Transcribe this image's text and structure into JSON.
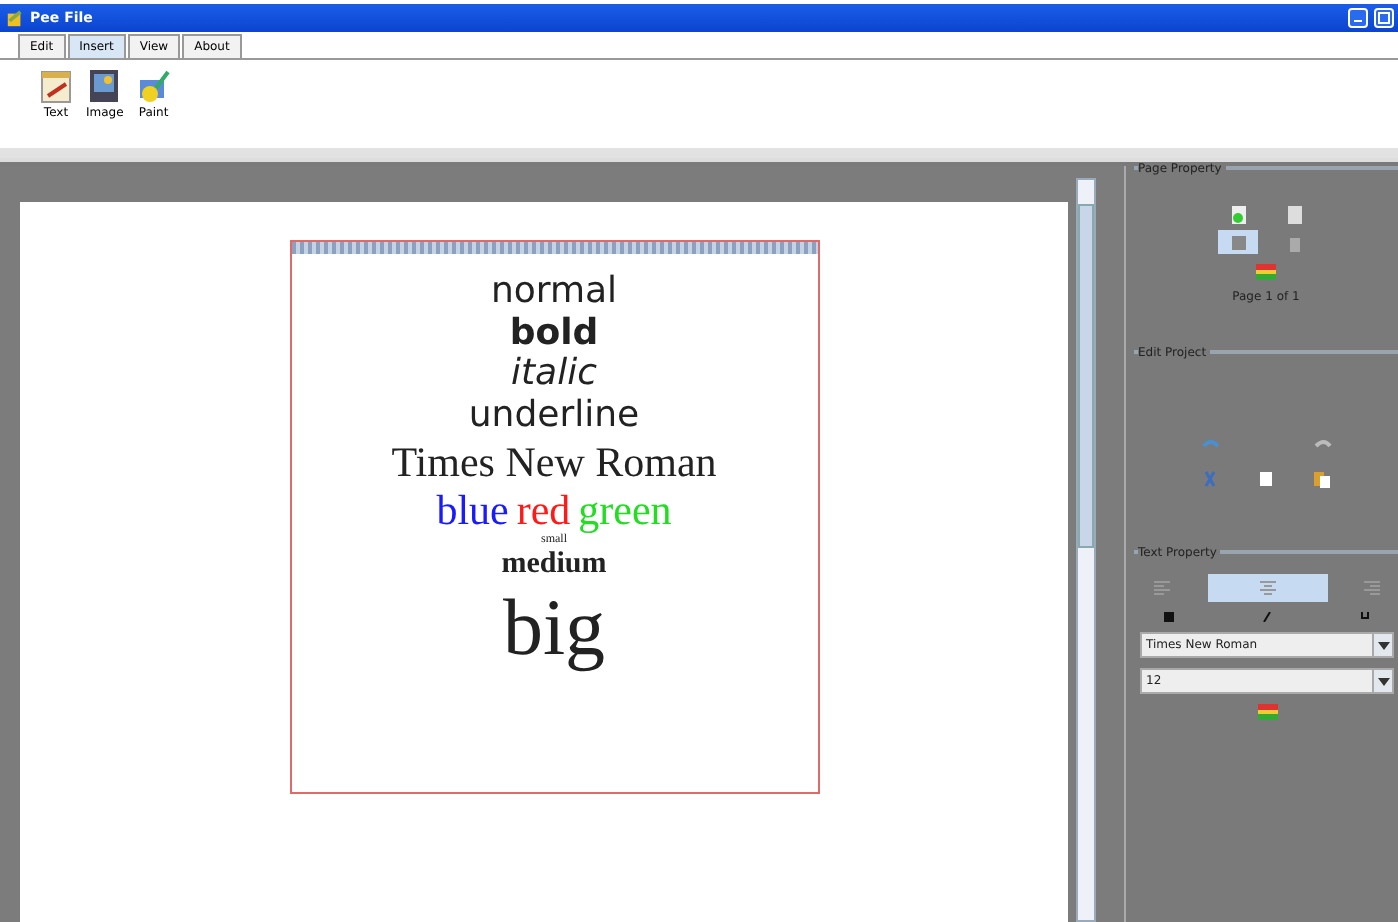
{
  "window": {
    "title": "Pee File"
  },
  "tabs": [
    {
      "label": "Edit",
      "selected": false
    },
    {
      "label": "Insert",
      "selected": true
    },
    {
      "label": "View",
      "selected": false
    },
    {
      "label": "About",
      "selected": false
    }
  ],
  "toolbar": [
    {
      "label": "Text",
      "kind": "text"
    },
    {
      "label": "Image",
      "kind": "image"
    },
    {
      "label": "Paint",
      "kind": "paint"
    }
  ],
  "document": {
    "lines": [
      {
        "kind": "normal",
        "segments": [
          {
            "text": "normal"
          }
        ]
      },
      {
        "kind": "bold",
        "segments": [
          {
            "text": "bold"
          }
        ]
      },
      {
        "kind": "italic",
        "segments": [
          {
            "text": "italic"
          }
        ]
      },
      {
        "kind": "underline",
        "segments": [
          {
            "text": "underline"
          }
        ]
      },
      {
        "kind": "times",
        "segments": [
          {
            "text": "Times New Roman"
          }
        ]
      },
      {
        "kind": "colored",
        "segments": [
          {
            "text": "blue",
            "color": "#1a1aff"
          },
          {
            "text": "red",
            "color": "#ff1a1a"
          },
          {
            "text": "green",
            "color": "#22dd22"
          }
        ]
      },
      {
        "kind": "small",
        "segments": [
          {
            "text": "small"
          }
        ]
      },
      {
        "kind": "medium",
        "segments": [
          {
            "text": "medium"
          }
        ]
      },
      {
        "kind": "big",
        "segments": [
          {
            "text": "big"
          }
        ]
      }
    ]
  },
  "page_property": {
    "title": "Page Property",
    "page_label": "Page 1 of 1"
  },
  "edit_project": {
    "title": "Edit Project"
  },
  "text_property": {
    "title": "Text Property",
    "alignments": [
      {
        "kind": "left",
        "selected": false
      },
      {
        "kind": "center",
        "selected": true
      },
      {
        "kind": "right",
        "selected": false
      }
    ],
    "font": "Times New Roman",
    "size": "12"
  }
}
